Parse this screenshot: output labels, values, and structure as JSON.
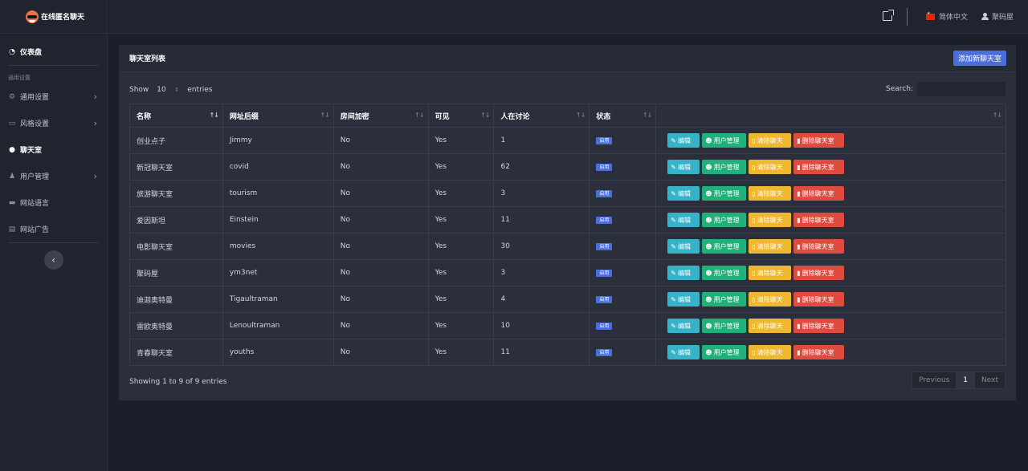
{
  "brand": {
    "name": "在线匿名聊天"
  },
  "sidebar": {
    "dashboard": "仪表盘",
    "section_label": "通用设置",
    "items": [
      {
        "label": "通用设置",
        "icon": "gear-icon"
      },
      {
        "label": "风格设置",
        "icon": "palette-icon"
      },
      {
        "label": "聊天室",
        "icon": "chat-icon"
      },
      {
        "label": "用户管理",
        "icon": "users-icon"
      },
      {
        "label": "网站语言",
        "icon": "keyboard-icon"
      },
      {
        "label": "网站广告",
        "icon": "ad-icon"
      }
    ]
  },
  "topbar": {
    "language": "简体中文",
    "user": "聚码屋"
  },
  "card": {
    "title": "聊天室列表",
    "add_button": "添加新聊天室"
  },
  "controls": {
    "show_label": "Show",
    "entries_value": "10",
    "entries_label": "entries",
    "search_label": "Search:"
  },
  "table": {
    "headers": [
      "名称",
      "网址后缀",
      "房间加密",
      "可见",
      "人在讨论",
      "状态",
      ""
    ],
    "status_badge": "启用",
    "actions": {
      "edit": "编辑",
      "users": "用户管理",
      "clear": "清除聊天",
      "delete": "删除聊天室"
    },
    "rows": [
      {
        "name": "创业点子",
        "slug": "Jimmy",
        "encrypted": "No",
        "visible": "Yes",
        "online": "1"
      },
      {
        "name": "新冠聊天室",
        "slug": "covid",
        "encrypted": "No",
        "visible": "Yes",
        "online": "62"
      },
      {
        "name": "旅游聊天室",
        "slug": "tourism",
        "encrypted": "No",
        "visible": "Yes",
        "online": "3"
      },
      {
        "name": "爱因斯坦",
        "slug": "Einstein",
        "encrypted": "No",
        "visible": "Yes",
        "online": "11"
      },
      {
        "name": "电影聊天室",
        "slug": "movies",
        "encrypted": "No",
        "visible": "Yes",
        "online": "30"
      },
      {
        "name": "聚码屋",
        "slug": "ym3net",
        "encrypted": "No",
        "visible": "Yes",
        "online": "3"
      },
      {
        "name": "迪迦奥特曼",
        "slug": "Tigaultraman",
        "encrypted": "No",
        "visible": "Yes",
        "online": "4"
      },
      {
        "name": "雷欧奥特曼",
        "slug": "Lenoultraman",
        "encrypted": "No",
        "visible": "Yes",
        "online": "10"
      },
      {
        "name": "青春聊天室",
        "slug": "youths",
        "encrypted": "No",
        "visible": "Yes",
        "online": "11"
      }
    ]
  },
  "footer": {
    "info": "Showing 1 to 9 of 9 entries",
    "previous": "Previous",
    "page": "1",
    "next": "Next"
  }
}
